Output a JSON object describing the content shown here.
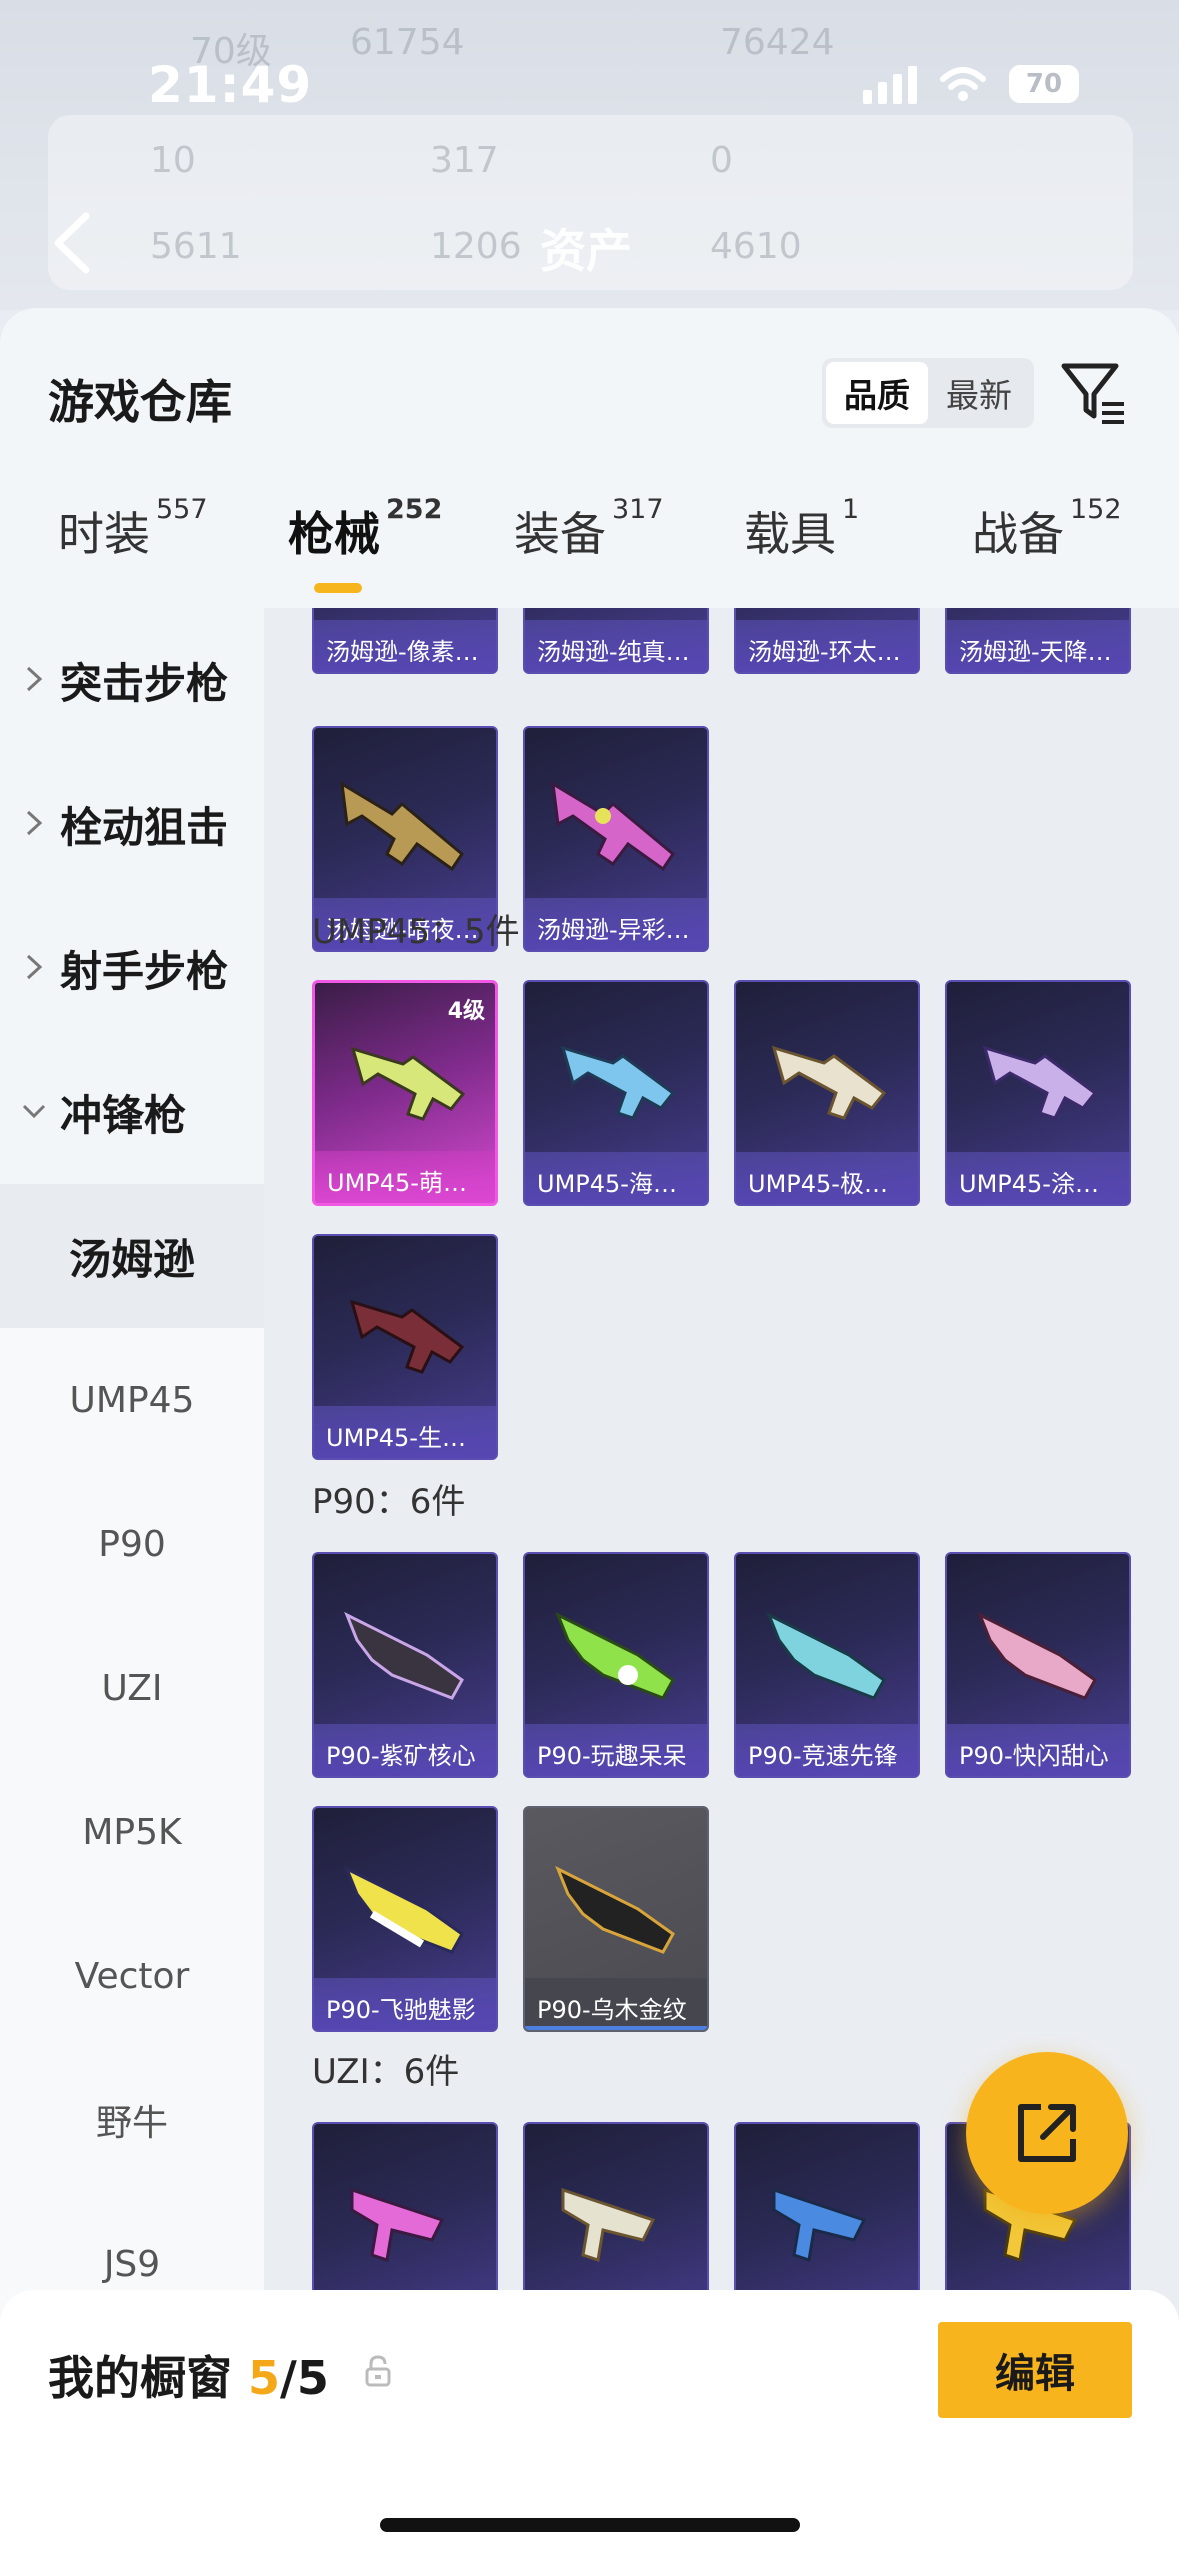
{
  "status": {
    "time": "21:49",
    "battery": "70"
  },
  "header": {
    "ghost_level": "70级",
    "ghost_num_1": "61754",
    "ghost_num_2": "76424",
    "ghost_stats_row1": [
      "10",
      "317",
      "0"
    ],
    "ghost_stats_row2": [
      "5611",
      "1206",
      "4610"
    ],
    "title": "资产"
  },
  "sheet": {
    "title": "游戏仓库",
    "sort": {
      "quality": "品质",
      "latest": "最新",
      "active": "品质"
    }
  },
  "tabs": [
    {
      "label": "时装",
      "count": "557"
    },
    {
      "label": "枪械",
      "count": "252",
      "active": true
    },
    {
      "label": "装备",
      "count": "317"
    },
    {
      "label": "载具",
      "count": "1"
    },
    {
      "label": "战备",
      "count": "152"
    }
  ],
  "sidebar": {
    "categories": [
      "突击步枪",
      "栓动狙击",
      "射手步枪",
      "冲锋枪"
    ],
    "subitems": [
      "汤姆逊",
      "UMP45",
      "P90",
      "UZI",
      "MP5K",
      "Vector",
      "野牛",
      "JS9"
    ],
    "active": "汤姆逊"
  },
  "sections": {
    "thompson_row1": [
      "汤姆逊-像素…",
      "汤姆逊-纯真…",
      "汤姆逊-环太…",
      "汤姆逊-天降…"
    ],
    "thompson_row2": [
      "汤姆逊-暗夜…",
      "汤姆逊-异彩…"
    ],
    "ump_label": "UMP45：5件",
    "ump_items": [
      "UMP45-萌…",
      "UMP45-海…",
      "UMP45-极…",
      "UMP45-涂…",
      "UMP45-生…"
    ],
    "ump_badge": "4级",
    "p90_label": "P90：6件",
    "p90_items": [
      "P90-紫矿核心",
      "P90-玩趣呆呆",
      "P90-竞速先锋",
      "P90-快闪甜心",
      "P90-飞驰魅影",
      "P90-乌木金纹"
    ],
    "uzi_label": "UZI：6件"
  },
  "bottom": {
    "showcase_label": "我的橱窗",
    "count": "5",
    "total": "/5",
    "edit": "编辑"
  },
  "colors": {
    "accent": "#f7b41d",
    "card": "#2b2a56",
    "legend": "#d64bd0"
  }
}
